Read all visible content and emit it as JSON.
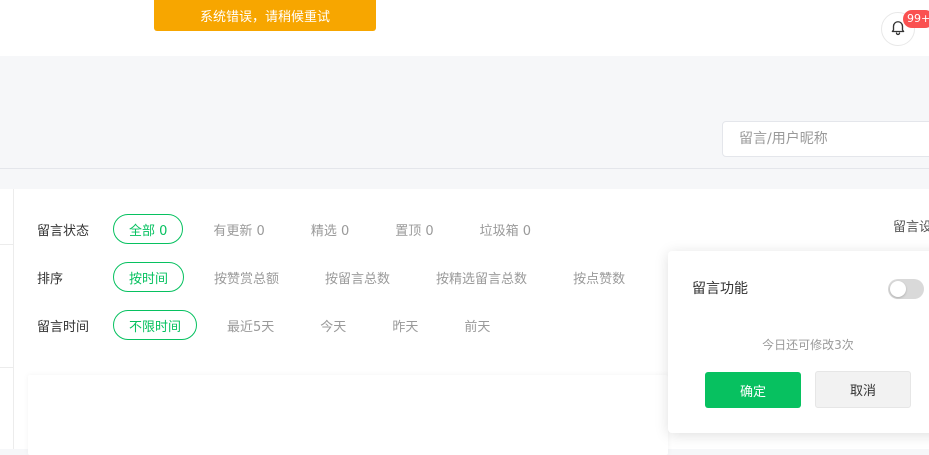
{
  "toast": {
    "text": "系统错误，请稍候重试"
  },
  "notifications": {
    "badge": "99+",
    "icon": "bell-icon"
  },
  "search": {
    "placeholder": "留言/用户昵称"
  },
  "filters": {
    "status": {
      "label": "留言状态",
      "options": [
        "全部 0",
        "有更新 0",
        "精选 0",
        "置顶 0",
        "垃圾箱 0"
      ],
      "selected": "全部 0"
    },
    "sort": {
      "label": "排序",
      "options": [
        "按时间",
        "按赞赏总额",
        "按留言总数",
        "按精选留言总数",
        "按点赞数"
      ],
      "selected": "按时间"
    },
    "time": {
      "label": "留言时间",
      "options": [
        "不限时间",
        "最近5天",
        "今天",
        "昨天",
        "前天"
      ],
      "selected": "不限时间"
    }
  },
  "settings_link": "留言设",
  "popover": {
    "title": "留言功能",
    "toggle_on": false,
    "hint": "今日还可修改3次",
    "confirm": "确定",
    "cancel": "取消"
  },
  "colors": {
    "accent": "#07c160",
    "toast": "#f7a600",
    "badge": "#fa5151"
  }
}
